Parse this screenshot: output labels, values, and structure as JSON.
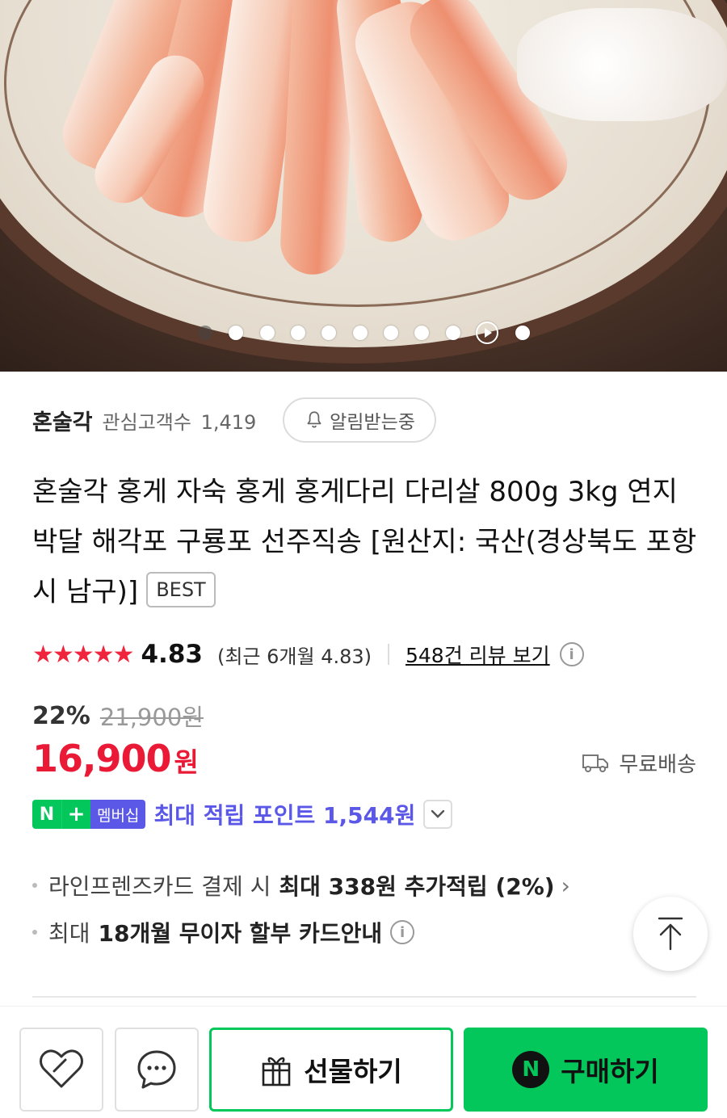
{
  "gallery": {
    "image_alt": "product-photo-crab-legs",
    "dot_count": 11,
    "active_index": 0,
    "video_index": 9
  },
  "store": {
    "name": "혼술각",
    "interest_label": "관심고객수",
    "interest_count": "1,419",
    "notify_label": "알림받는중"
  },
  "product": {
    "title": "혼술각 홍게 자숙 홍게 홍게다리 다리살 800g 3kg 연지 박달 해각포 구룡포 선주직송 [원산지: 국산(경상북도 포항시 남구)]",
    "badge": "BEST"
  },
  "rating": {
    "stars": "★★★★★",
    "score": "4.83",
    "recent": "(최근 6개월 4.83)",
    "review_link": "548건 리뷰 보기",
    "info_icon": "ⓘ"
  },
  "price": {
    "discount": "22%",
    "original": "21,900원",
    "current": "16,900",
    "currency": "원",
    "shipping": "무료배송"
  },
  "membership": {
    "n": "N",
    "plus": "+",
    "label": "멤버십",
    "text": "최대 적립 포인트 1,544원"
  },
  "benefits": [
    {
      "prefix": "라인프렌즈카드 결제 시",
      "bold": "최대 338원 추가적립 (2%)",
      "suffix": "›"
    },
    {
      "prefix": "최대",
      "bold": "18개월 무이자 할부 카드안내",
      "suffix": "i"
    }
  ],
  "actions": {
    "gift": "선물하기",
    "buy": "구매하기",
    "npay_mark": "N"
  },
  "colors": {
    "accent_green": "#03c75a",
    "price_red": "#ea1a36",
    "membership_purple": "#5b58e8"
  }
}
